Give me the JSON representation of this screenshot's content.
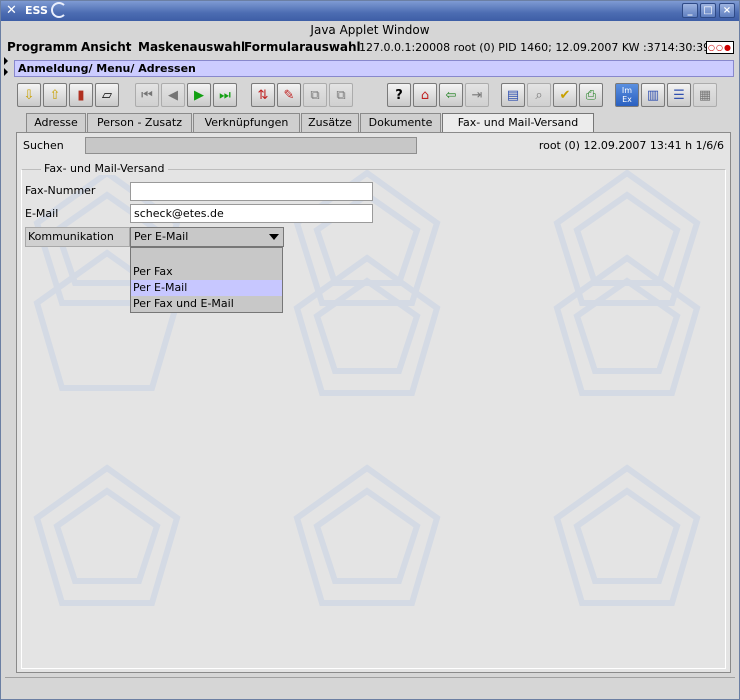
{
  "window": {
    "app_title": "ESS",
    "applet_title": "Java Applet Window",
    "controls": [
      "_",
      "□",
      "×"
    ]
  },
  "menubar": {
    "items": [
      "Programm",
      "Ansicht",
      "Maskenauswahl",
      "Formularauswahl"
    ],
    "status": "127.0.0.1:20008 root (0) PID 1460; 12.09.2007 KW :3714:30:39",
    "indicator": "○○●"
  },
  "breadcrumb": "Anmeldung/ Menu/ Adressen",
  "toolbar": {
    "icons": [
      "save-icon",
      "save-all-icon",
      "delete-icon",
      "new-record-icon",
      "first-record-icon",
      "prev-record-icon",
      "next-record-icon",
      "last-record-icon",
      "compare-icon",
      "edit-record-icon",
      "copy-icon",
      "paste-icon",
      "help-icon",
      "home-icon",
      "exit-icon",
      "export-icon",
      "document-icon",
      "search-icon",
      "check-icon",
      "print-icon",
      "import-export-icon",
      "card-icon",
      "list-icon",
      "report-icon"
    ],
    "import_export_label": "Im Ex"
  },
  "tabs": [
    "Adresse",
    "Person - Zusatz",
    "Verknüpfungen",
    "Zusätze",
    "Dokumente",
    "Fax- und Mail-Versand"
  ],
  "form": {
    "search_label": "Suchen",
    "search_value": "",
    "session_info": "root (0)  12.09.2007 13:41 h 1/6/6",
    "group_title": "Fax- und Mail-Versand",
    "fax_label": "Fax-Nummer",
    "fax_value": "",
    "email_label": "E-Mail",
    "email_value": "scheck@etes.de",
    "komm_label": "Kommunikation",
    "komm_value": "Per E-Mail",
    "komm_options": [
      "",
      "Per Fax",
      "Per E-Mail",
      "Per Fax und E-Mail"
    ],
    "komm_selected_index": 2
  }
}
